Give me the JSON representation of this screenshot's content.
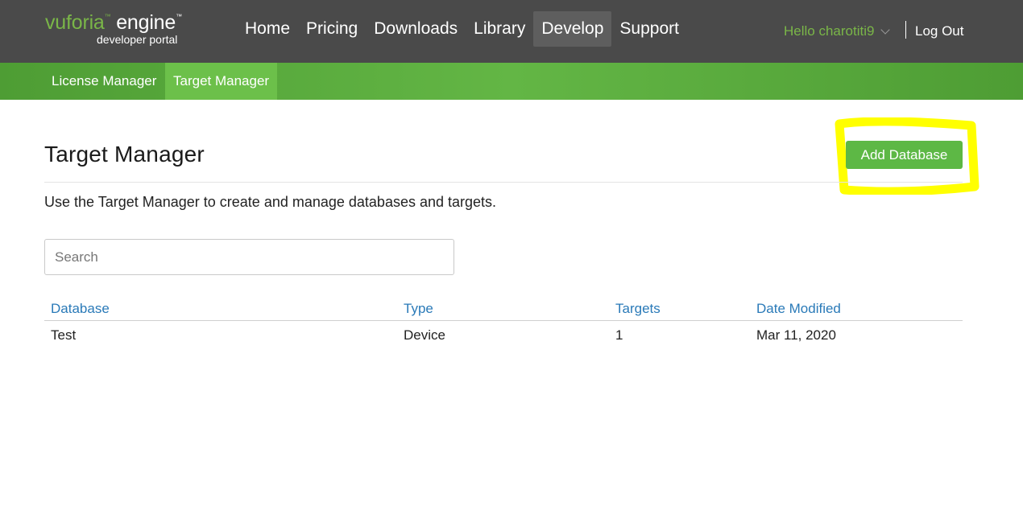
{
  "header": {
    "logo": {
      "brand": "vuforia",
      "brand_tm": "™",
      "product": "engine",
      "product_tm": "™",
      "subtitle": "developer portal"
    },
    "nav": [
      {
        "label": "Home",
        "active": false
      },
      {
        "label": "Pricing",
        "active": false
      },
      {
        "label": "Downloads",
        "active": false
      },
      {
        "label": "Library",
        "active": false
      },
      {
        "label": "Develop",
        "active": true
      },
      {
        "label": "Support",
        "active": false
      }
    ],
    "user_greeting": "Hello charotiti9",
    "logout_label": "Log Out"
  },
  "subnav": [
    {
      "label": "License Manager",
      "active": false
    },
    {
      "label": "Target Manager",
      "active": true
    }
  ],
  "main": {
    "title": "Target Manager",
    "add_button_label": "Add Database",
    "description": "Use the Target Manager to create and manage databases and targets.",
    "search": {
      "placeholder": "Search",
      "value": ""
    },
    "table": {
      "columns": [
        "Database",
        "Type",
        "Targets",
        "Date Modified"
      ],
      "rows": [
        [
          "Test",
          "Device",
          "1",
          "Mar 11, 2020"
        ]
      ]
    }
  },
  "colors": {
    "header_bg": "#4a4a4a",
    "brand_green": "#7ab648",
    "button_green": "#5db845",
    "link_blue": "#2a7ab8",
    "highlight_yellow": "#ffff00"
  }
}
